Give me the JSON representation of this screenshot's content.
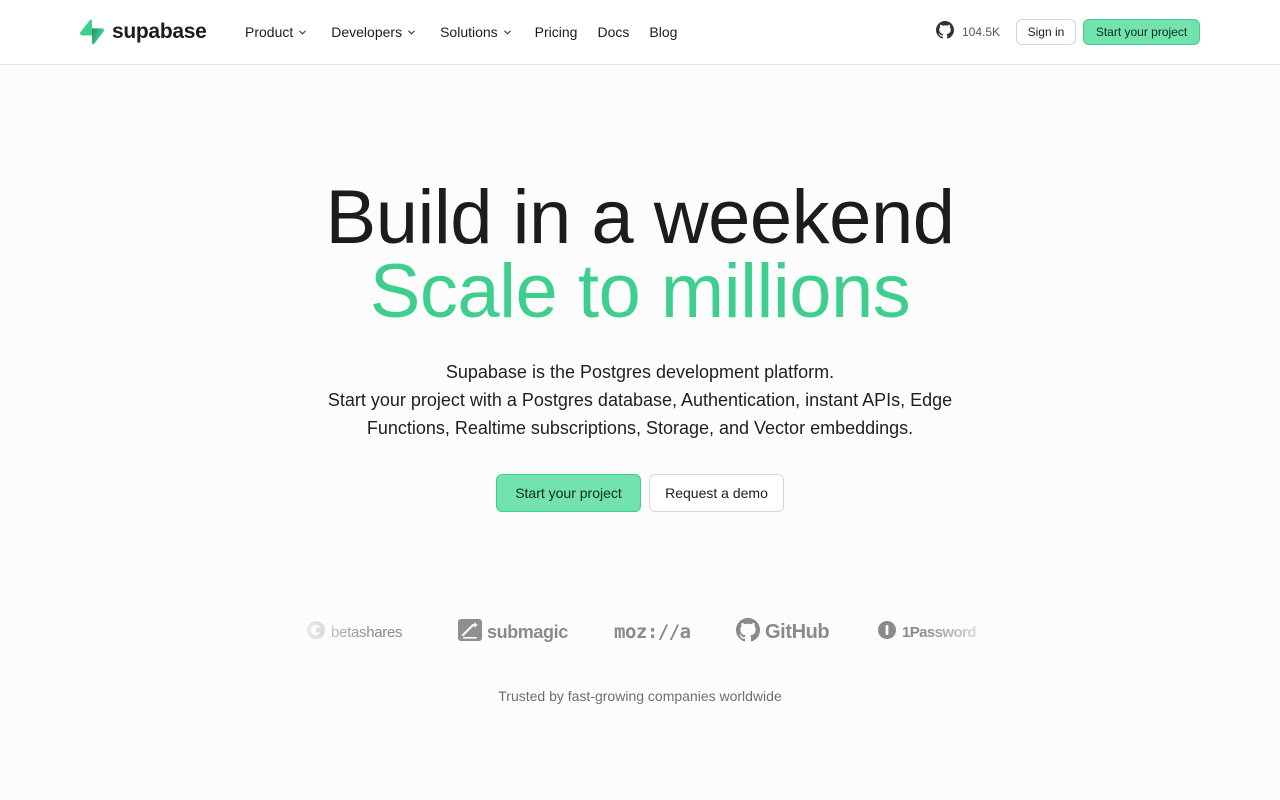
{
  "brand": {
    "name": "supabase",
    "accent": "#3ecf8e",
    "button_fill": "#72e3ad"
  },
  "nav": {
    "items": [
      {
        "label": "Product",
        "dropdown": true
      },
      {
        "label": "Developers",
        "dropdown": true
      },
      {
        "label": "Solutions",
        "dropdown": true
      },
      {
        "label": "Pricing",
        "dropdown": false
      },
      {
        "label": "Docs",
        "dropdown": false
      },
      {
        "label": "Blog",
        "dropdown": false
      }
    ]
  },
  "header_actions": {
    "github_icon": "github-icon",
    "github_stars": "104.5K",
    "sign_in": "Sign in",
    "start_project": "Start your project"
  },
  "hero": {
    "line1": "Build in a weekend",
    "line2": "Scale to millions",
    "description": [
      "Supabase is the Postgres development platform.",
      "Start your project with a Postgres database, Authentication, instant APIs, Edge",
      "Functions, Realtime subscriptions, Storage, and Vector embeddings."
    ],
    "primary_cta": "Start your project",
    "secondary_cta": "Request a demo"
  },
  "customers": {
    "logos": [
      {
        "name": "betashares",
        "icon": "betashares-icon"
      },
      {
        "name": "submagic",
        "icon": "submagic-icon"
      },
      {
        "name": "moz://a",
        "icon": ""
      },
      {
        "name": "GitHub",
        "icon": "github-icon"
      },
      {
        "name": "1Password",
        "icon": "1password-icon"
      }
    ],
    "caption": "Trusted by fast-growing companies worldwide"
  }
}
